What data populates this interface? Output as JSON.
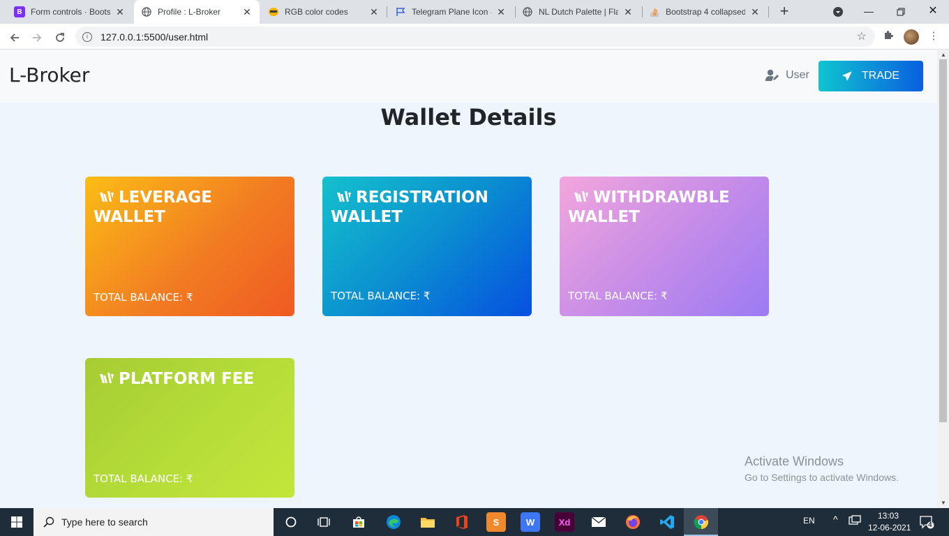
{
  "browser": {
    "tabs": [
      {
        "title": "Form controls · Bootst",
        "favicon": "B",
        "favicon_color": "#7b2ff7"
      },
      {
        "title": "Profile : L-Broker",
        "favicon": "globe",
        "favicon_color": "#5f6368"
      },
      {
        "title": "RGB color codes",
        "favicon": "rgb-logo",
        "favicon_color": "#f4b400"
      },
      {
        "title": "Telegram Plane Icon -",
        "favicon": "flag",
        "favicon_color": "#3367d6"
      },
      {
        "title": "NL Dutch Palette | Flat",
        "favicon": "globe",
        "favicon_color": "#5f6368"
      },
      {
        "title": "Bootstrap 4 collapsed",
        "favicon": "stack",
        "favicon_color": "#f48024"
      }
    ],
    "url": "127.0.0.1:5500/user.html"
  },
  "navbar": {
    "brand": "L-Broker",
    "user_label": "User",
    "trade_label": "TRADE"
  },
  "page": {
    "title": "Wallet Details"
  },
  "wallets": [
    {
      "title": "LEVERAGE WALLET",
      "balance": "TOTAL BALANCE: ₹"
    },
    {
      "title": "REGISTRATION WALLET",
      "balance": "TOTAL BALANCE: ₹"
    },
    {
      "title": "WITHDRAWBLE WALLET",
      "balance": "TOTAL BALANCE: ₹"
    },
    {
      "title": "PLATFORM FEE",
      "balance": "TOTAL BALANCE: ₹"
    }
  ],
  "watermark": {
    "line1": "Activate Windows",
    "line2": "Go to Settings to activate Windows."
  },
  "taskbar": {
    "search_placeholder": "Type here to search",
    "language": "EN",
    "time": "13:03",
    "date": "12-06-2021",
    "notification_count": "4"
  }
}
